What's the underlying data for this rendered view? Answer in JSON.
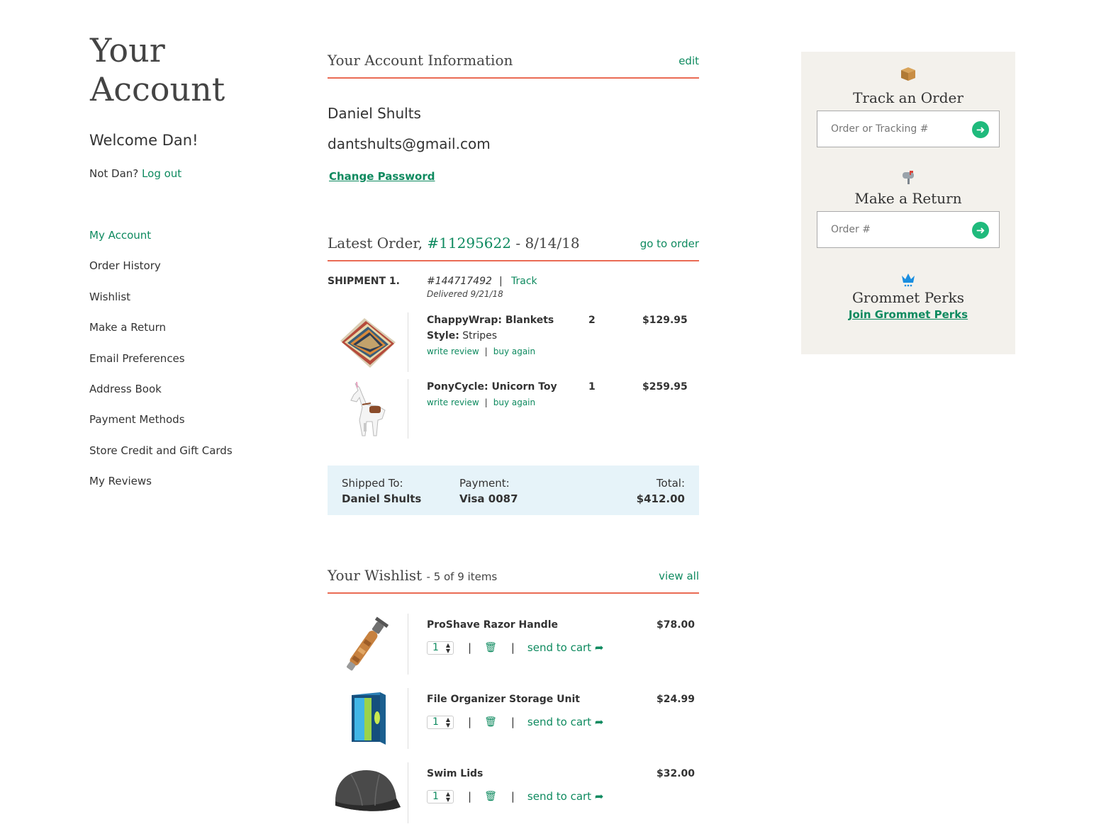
{
  "sidebar": {
    "title": "Your Account",
    "welcome": "Welcome Dan!",
    "not_user": "Not Dan?",
    "logout": "Log out",
    "nav": [
      {
        "label": "My Account"
      },
      {
        "label": "Order History"
      },
      {
        "label": "Wishlist"
      },
      {
        "label": "Make a Return"
      },
      {
        "label": "Email Preferences"
      },
      {
        "label": "Address Book"
      },
      {
        "label": "Payment Methods"
      },
      {
        "label": "Store Credit and Gift Cards"
      },
      {
        "label": "My Reviews"
      }
    ]
  },
  "account": {
    "heading": "Your Account Information",
    "edit": "edit",
    "name": "Daniel Shults",
    "email": "dantshults@gmail.com",
    "change_password": "Change Password"
  },
  "latest_order": {
    "heading_prefix": "Latest Order,",
    "order_number": "#11295622",
    "date": "- 8/14/18",
    "go_to_order": "go to order",
    "shipment_label": "SHIPMENT 1.",
    "shipment_number": "#144717492",
    "separator": "|",
    "track": "Track",
    "delivered": "Delivered 9/21/18",
    "items": [
      {
        "name": "ChappyWrap: Blankets",
        "style_label": "Style:",
        "style_value": "Stripes",
        "qty": "2",
        "price": "$129.95",
        "write_review": "write review",
        "buy_again": "buy again",
        "icon": "striped-blanket-image"
      },
      {
        "name": "PonyCycle: Unicorn Toy",
        "qty": "1",
        "price": "$259.95",
        "write_review": "write review",
        "buy_again": "buy again",
        "icon": "unicorn-toy-image"
      }
    ],
    "summary": {
      "shipped_to_label": "Shipped To:",
      "shipped_to": "Daniel Shults",
      "payment_label": "Payment:",
      "payment": "Visa 0087",
      "total_label": "Total:",
      "total": "$412.00"
    }
  },
  "wishlist": {
    "heading": "Your Wishlist",
    "count": "- 5 of 9 items",
    "view_all": "view all",
    "send_to_cart": "send to cart",
    "items": [
      {
        "name": "ProShave Razor Handle",
        "price": "$78.00",
        "qty": "1",
        "icon": "razor-handle-image"
      },
      {
        "name": "File Organizer Storage Unit",
        "price": "$24.99",
        "qty": "1",
        "icon": "file-organizer-image"
      },
      {
        "name": "Swim Lids",
        "price": "$32.00",
        "qty": "1",
        "icon": "swim-cap-image"
      }
    ]
  },
  "right_panel": {
    "track_title": "Track an Order",
    "track_placeholder": "Order or Tracking #",
    "return_title": "Make a Return",
    "return_placeholder": "Order #",
    "perks_title": "Grommet Perks",
    "perks_link": "Join Grommet Perks",
    "icons": [
      "package-icon",
      "mailbox-icon",
      "crown-icon",
      "arrow-right-icon"
    ]
  },
  "colors": {
    "accent_green": "#0e8a5f",
    "button_green": "#1fba7c",
    "divider_red": "#ea6b54",
    "summary_bg": "#e6f3f9",
    "panel_bg": "#f3f1ec"
  }
}
